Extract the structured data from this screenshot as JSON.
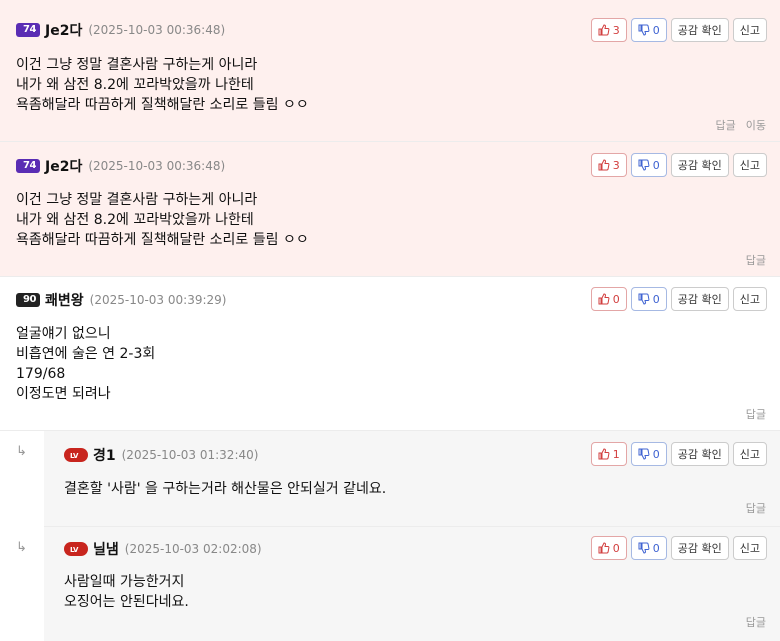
{
  "comments": [
    {
      "level": "74",
      "nickname": "Je2다",
      "date": "(2025-10-03 00:36:48)",
      "up": "3",
      "down": "0",
      "empathy": "공감 확인",
      "report": "신고",
      "lines": [
        "이건 그냥 정말 결혼사람 구하는게 아니라",
        "내가 왜 삼전 8.2에 꼬라박았을까 나한테",
        "욕좀해달라 따끔하게 질책해달란 소리로 들림 ㅇㅇ"
      ],
      "reply": "답글",
      "move": "이동"
    },
    {
      "level": "74",
      "nickname": "Je2다",
      "date": "(2025-10-03 00:36:48)",
      "up": "3",
      "down": "0",
      "empathy": "공감 확인",
      "report": "신고",
      "lines": [
        "이건 그냥 정말 결혼사람 구하는게 아니라",
        "내가 왜 삼전 8.2에 꼬라박았을까 나한테",
        "욕좀해달라 따끔하게 질책해달란 소리로 들림 ㅇㅇ"
      ],
      "reply": "답글"
    },
    {
      "level": "90",
      "nickname": "쾌변왕",
      "date": "(2025-10-03 00:39:29)",
      "up": "0",
      "down": "0",
      "empathy": "공감 확인",
      "report": "신고",
      "lines": [
        "얼굴얘기 없으니",
        "비흡연에 술은 연 2-3회",
        "179/68",
        "이정도면 되려나"
      ],
      "reply": "답글"
    },
    {
      "level": "LV",
      "nickname": "경1",
      "date": "(2025-10-03 01:32:40)",
      "up": "1",
      "down": "0",
      "empathy": "공감 확인",
      "report": "신고",
      "lines": [
        "결혼할 '사람' 을 구하는거라 해산물은 안되실거 같네요."
      ],
      "reply": "답글"
    },
    {
      "level": "LV",
      "nickname": "닐냄",
      "date": "(2025-10-03 02:02:08)",
      "up": "0",
      "down": "0",
      "empathy": "공감 확인",
      "report": "신고",
      "lines": [
        "사람일때 가능한거지",
        "오징어는 안된다네요."
      ],
      "reply": "답글"
    }
  ],
  "reply_arrow": "↳",
  "colors": {
    "highlight_bg": "#fef0ee",
    "reply_bg": "#f6f6f6",
    "up": "#d23f3f",
    "down": "#3f63d2"
  },
  "icons": {
    "up": "thumbs-up-icon",
    "down": "thumbs-down-icon",
    "reply_arrow": "reply-arrow-icon"
  }
}
